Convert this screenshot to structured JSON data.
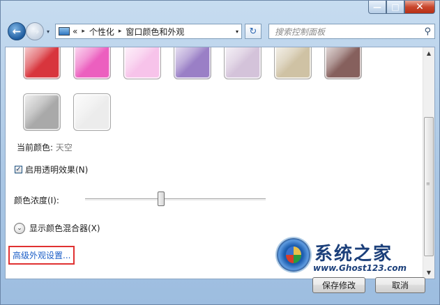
{
  "window": {
    "caption": {
      "minimize": "—",
      "maximize": "□",
      "close": "✕"
    }
  },
  "navbar": {
    "history_arrow": "▾",
    "overflow": "«",
    "breadcrumbs": [
      "个性化",
      "窗口颜色和外观"
    ],
    "separator": "▸",
    "dropdown": "▾",
    "refresh": "↻",
    "search_placeholder": "搜索控制面板",
    "search_icon": "⚲"
  },
  "swatches": [
    {
      "name": "red",
      "color": "#d8353d"
    },
    {
      "name": "fuchsia",
      "color": "#ec5fbf"
    },
    {
      "name": "light-pink",
      "color": "#f7c3ea"
    },
    {
      "name": "violet",
      "color": "#9a7fc6"
    },
    {
      "name": "lavender",
      "color": "#d4c3da"
    },
    {
      "name": "taupe",
      "color": "#cfc2a4"
    },
    {
      "name": "chocolate",
      "color": "#86605d"
    },
    {
      "name": "slate",
      "color": "#a9a9a9"
    },
    {
      "name": "frost",
      "color": "#ececec"
    }
  ],
  "current_color": {
    "label": "当前颜色: ",
    "value": "天空"
  },
  "transparency": {
    "label": "启用透明效果(N)",
    "checked": true,
    "checkmark": "✓"
  },
  "intensity": {
    "label": "颜色浓度(I):",
    "value_fraction": 0.42
  },
  "mixer": {
    "label": "显示颜色混合器(X)",
    "icon": "⌄"
  },
  "advanced_link": "高级外观设置...",
  "scrollbar": {
    "up": "▲",
    "down": "▼",
    "grip": "≡"
  },
  "watermark": {
    "title": "系统之家",
    "url": "www.Ghost123.com"
  },
  "buttons": {
    "save": "保存修改",
    "cancel": "取消"
  },
  "colors": {
    "link": "#1b5ec7",
    "highlight_border": "#e03131",
    "chrome": "#b6cfe8"
  }
}
